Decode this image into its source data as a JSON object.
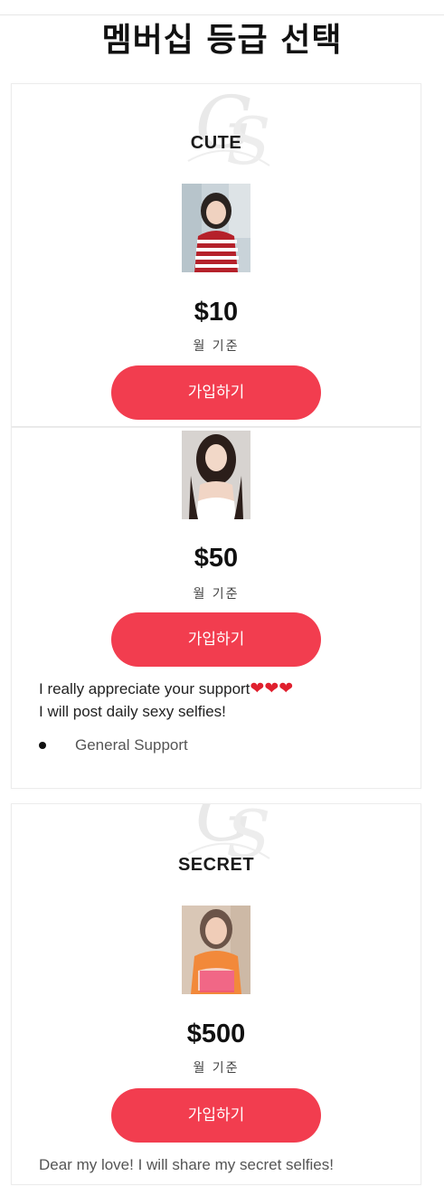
{
  "page": {
    "title": "멤버십 등급 선택"
  },
  "tiers": [
    {
      "name": "CUTE",
      "price": "$10",
      "period": "월 기준",
      "button": "가입하기",
      "photo_icon": "model-photo-striped-sweater"
    },
    {
      "name": "",
      "price": "$50",
      "period": "월 기준",
      "button": "가입하기",
      "description_line1": "I really appreciate your support",
      "hearts": "❤❤❤",
      "description_line2": "I will post daily sexy selfies!",
      "benefit": "General Support",
      "photo_icon": "model-photo-white-top"
    },
    {
      "name": "SECRET",
      "price": "$500",
      "period": "월 기준",
      "button": "가입하기",
      "description_line1": "Dear my love! I will share my secret selfies!",
      "photo_icon": "model-photo-orange-top-censored"
    }
  ],
  "watermark_icon": "gs-monogram-icon",
  "colors": {
    "button": "#f23d4f",
    "heart": "#e0202e",
    "text": "#1a1a1a"
  }
}
